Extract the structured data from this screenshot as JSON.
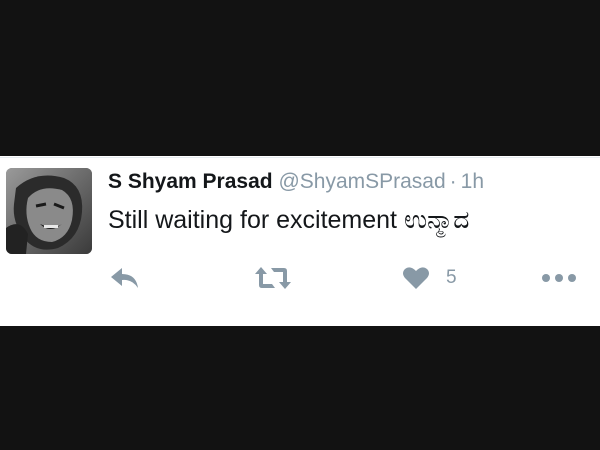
{
  "tweet": {
    "display_name": "S Shyam Prasad",
    "handle": "@ShyamSPrasad",
    "separator": "·",
    "time": "1h",
    "text": "Still waiting for excitement ಉನ್ಮಾದ",
    "like_count": "5"
  },
  "icons": {
    "reply": "reply-icon",
    "retweet": "retweet-icon",
    "like": "heart-icon",
    "more": "more-dots-icon"
  },
  "colors": {
    "background_band": "#121212",
    "card": "#ffffff",
    "muted": "#8899a6",
    "text": "#14171a"
  }
}
